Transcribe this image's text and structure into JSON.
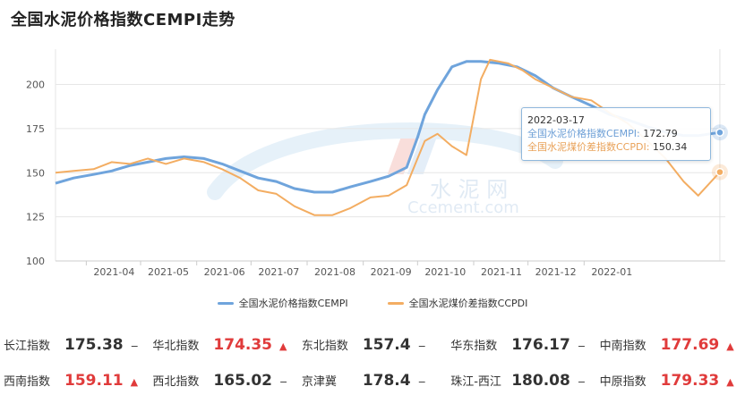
{
  "title": "全国水泥价格指数CEMPI走势",
  "watermark": {
    "text1": "水 泥 网",
    "text2": "Ccement.com"
  },
  "tooltip": {
    "date": "2022-03-17",
    "line1_label": "全国水泥价格指数CEMPI",
    "line1_value": "172.79",
    "line2_label": "全国水泥煤价差指数CCPDI",
    "line2_value": "150.34"
  },
  "legend": {
    "cempi": "全国水泥价格指数CEMPI",
    "ccpdi": "全国水泥煤价差指数CCPDI"
  },
  "colors": {
    "cempi": "#6fa4dc",
    "ccpdi": "#f3ad62",
    "up": "#e03b3b"
  },
  "chart_data": {
    "type": "line",
    "x_ticks": [
      "2021-04",
      "2021-05",
      "2021-06",
      "2021-07",
      "2021-08",
      "2021-09",
      "2021-10",
      "2021-11",
      "2021-12",
      "2022-01"
    ],
    "y_ticks": [
      100,
      125,
      150,
      175,
      200
    ],
    "ylim": [
      100,
      220
    ],
    "xlim": [
      "2021-03-15",
      "2022-03-20"
    ],
    "grid": "horizontal",
    "legend_position": "bottom",
    "series": [
      {
        "name": "全国水泥价格指数CEMPI",
        "points": [
          [
            "2021-03-15",
            144
          ],
          [
            "2021-03-25",
            147
          ],
          [
            "2021-04-05",
            149
          ],
          [
            "2021-04-15",
            151
          ],
          [
            "2021-04-25",
            154
          ],
          [
            "2021-05-05",
            156
          ],
          [
            "2021-05-15",
            158
          ],
          [
            "2021-05-25",
            159
          ],
          [
            "2021-06-05",
            158
          ],
          [
            "2021-06-15",
            155
          ],
          [
            "2021-06-25",
            151
          ],
          [
            "2021-07-05",
            147
          ],
          [
            "2021-07-15",
            145
          ],
          [
            "2021-07-25",
            141
          ],
          [
            "2021-08-05",
            139
          ],
          [
            "2021-08-15",
            139
          ],
          [
            "2021-08-25",
            142
          ],
          [
            "2021-09-05",
            145
          ],
          [
            "2021-09-15",
            148
          ],
          [
            "2021-09-25",
            153
          ],
          [
            "2021-10-01",
            170
          ],
          [
            "2021-10-05",
            183
          ],
          [
            "2021-10-12",
            197
          ],
          [
            "2021-10-20",
            210
          ],
          [
            "2021-10-28",
            213
          ],
          [
            "2021-11-05",
            213
          ],
          [
            "2021-11-15",
            212
          ],
          [
            "2021-11-25",
            210
          ],
          [
            "2021-12-05",
            205
          ],
          [
            "2021-12-15",
            198
          ],
          [
            "2021-12-25",
            193
          ],
          [
            "2022-01-05",
            188
          ],
          [
            "2022-01-15",
            183
          ],
          [
            "2022-01-25",
            180
          ],
          [
            "2022-02-05",
            176
          ],
          [
            "2022-02-15",
            173
          ],
          [
            "2022-02-25",
            171
          ],
          [
            "2022-03-05",
            171
          ],
          [
            "2022-03-17",
            172.79
          ]
        ]
      },
      {
        "name": "全国水泥煤价差指数CCPDI",
        "points": [
          [
            "2021-03-15",
            150
          ],
          [
            "2021-03-25",
            151
          ],
          [
            "2021-04-05",
            152
          ],
          [
            "2021-04-15",
            156
          ],
          [
            "2021-04-25",
            155
          ],
          [
            "2021-05-05",
            158
          ],
          [
            "2021-05-15",
            155
          ],
          [
            "2021-05-25",
            158
          ],
          [
            "2021-06-05",
            156
          ],
          [
            "2021-06-15",
            152
          ],
          [
            "2021-06-25",
            147
          ],
          [
            "2021-07-05",
            140
          ],
          [
            "2021-07-15",
            138
          ],
          [
            "2021-07-25",
            131
          ],
          [
            "2021-08-05",
            126
          ],
          [
            "2021-08-15",
            126
          ],
          [
            "2021-08-25",
            130
          ],
          [
            "2021-09-05",
            136
          ],
          [
            "2021-09-15",
            137
          ],
          [
            "2021-09-25",
            143
          ],
          [
            "2021-10-01",
            158
          ],
          [
            "2021-10-05",
            168
          ],
          [
            "2021-10-12",
            172
          ],
          [
            "2021-10-20",
            165
          ],
          [
            "2021-10-28",
            160
          ],
          [
            "2021-11-05",
            203
          ],
          [
            "2021-11-10",
            214
          ],
          [
            "2021-11-20",
            212
          ],
          [
            "2021-11-28",
            208
          ],
          [
            "2021-12-05",
            203
          ],
          [
            "2021-12-15",
            198
          ],
          [
            "2021-12-25",
            193
          ],
          [
            "2022-01-05",
            191
          ],
          [
            "2022-01-15",
            184
          ],
          [
            "2022-01-25",
            178
          ],
          [
            "2022-02-05",
            168
          ],
          [
            "2022-02-15",
            158
          ],
          [
            "2022-02-25",
            145
          ],
          [
            "2022-03-05",
            137
          ],
          [
            "2022-03-17",
            150.34
          ]
        ]
      }
    ]
  },
  "stats": [
    [
      {
        "label": "长江指数",
        "value": "175.38",
        "arrow": "−",
        "trend": "flat"
      },
      {
        "label": "华北指数",
        "value": "174.35",
        "arrow": "▲",
        "trend": "up"
      },
      {
        "label": "东北指数",
        "value": "157.4",
        "arrow": "−",
        "trend": "flat"
      },
      {
        "label": "华东指数",
        "value": "176.17",
        "arrow": "−",
        "trend": "flat"
      },
      {
        "label": "中南指数",
        "value": "177.69",
        "arrow": "▲",
        "trend": "up"
      }
    ],
    [
      {
        "label": "西南指数",
        "value": "159.11",
        "arrow": "▲",
        "trend": "up"
      },
      {
        "label": "西北指数",
        "value": "165.02",
        "arrow": "−",
        "trend": "flat"
      },
      {
        "label": "京津冀",
        "value": "178.4",
        "arrow": "−",
        "trend": "flat"
      },
      {
        "label": "珠江-西江",
        "value": "180.08",
        "arrow": "−",
        "trend": "flat"
      },
      {
        "label": "中原指数",
        "value": "179.33",
        "arrow": "▲",
        "trend": "up"
      }
    ]
  ]
}
